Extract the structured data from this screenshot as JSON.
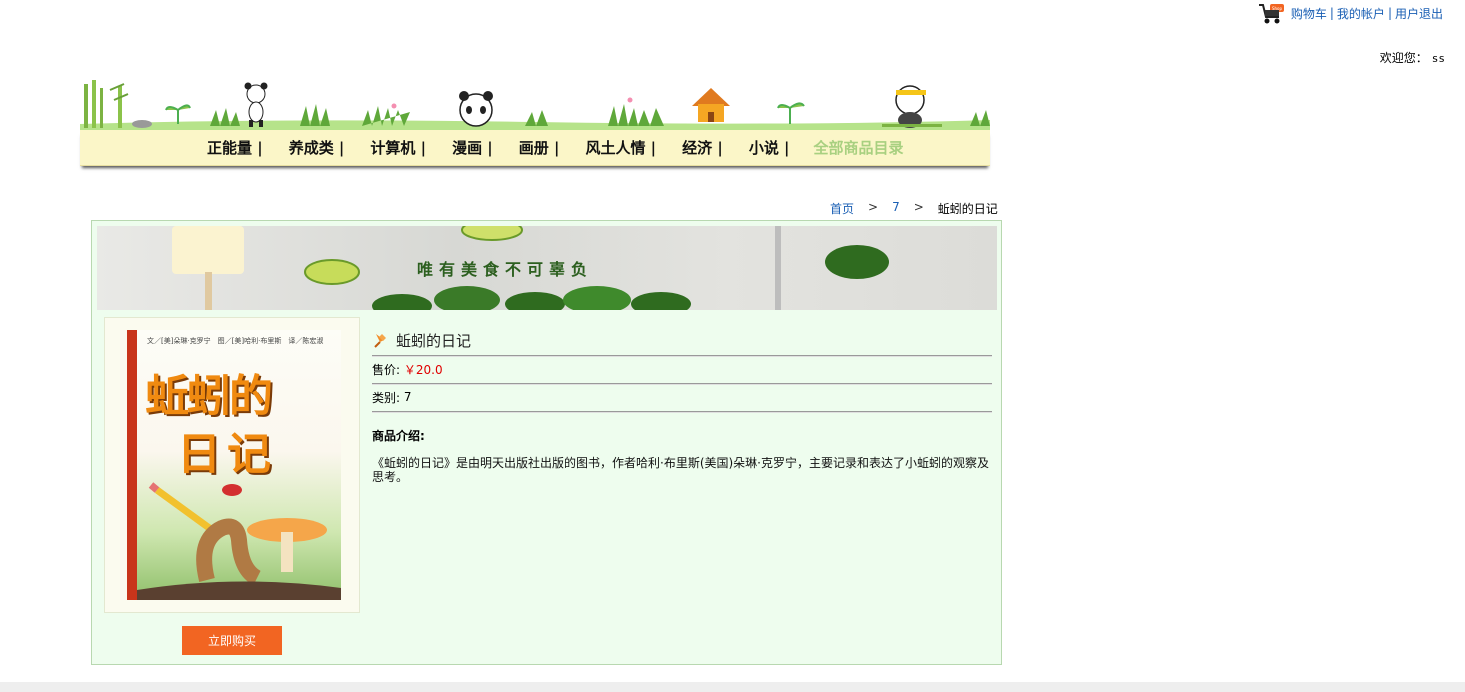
{
  "header": {
    "links": [
      "购物车",
      "我的帐户",
      "用户退出"
    ],
    "separator": "|",
    "welcome_label": "欢迎您：",
    "username": "ss"
  },
  "nav": {
    "items": [
      "正能量 |",
      "养成类 |",
      "计算机 |",
      "漫画 |",
      "画册 |",
      "风土人情 |",
      "经济 |",
      "小说 |"
    ],
    "all_label": "全部商品目录"
  },
  "breadcrumb": {
    "home": "首页",
    "separator": ">",
    "category": "7",
    "current": "蚯蚓的日记"
  },
  "promo": {
    "slogan": "唯有美食不可辜负"
  },
  "product": {
    "title": "蚯蚓的日记",
    "price_label": "售价:",
    "price": "￥20.0",
    "category_label": "类别:",
    "category": "7",
    "intro_label": "商品介绍:",
    "intro": "《蚯蚓的日记》是由明天出版社出版的图书，作者哈利·布里斯(美国)朵琳·克罗宁，主要记录和表达了小蚯蚓的观察及思考。",
    "buy_label": "立即购买"
  },
  "cover": {
    "top_line": "文／[美]朵琳·克罗宁　图／[美]哈利·布里斯　译／陈宏淑",
    "title_line1": "蚯蚓的",
    "title_line2": "日记"
  },
  "colors": {
    "accent": "#f26522",
    "panel_bg": "#eefdee",
    "price": "#e00000",
    "nav_bg": "#fbf6c8"
  }
}
